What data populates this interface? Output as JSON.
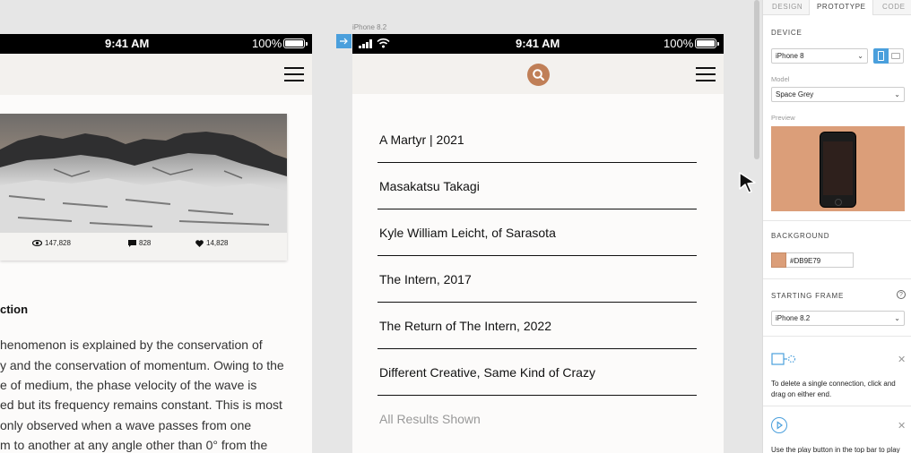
{
  "artboard_left": {
    "status": {
      "time": "9:41 AM",
      "battery": "100%"
    },
    "stats": {
      "views": "147,828",
      "comments": "828",
      "likes": "14,828"
    },
    "section_title": "ction",
    "body_lines": [
      "henomenon is explained by the conservation of",
      "y and the conservation of momentum. Owing to the",
      "e of medium, the phase velocity of the wave is",
      "ed but its frequency remains constant. This is most",
      "only observed when a wave passes from one",
      "m to another at any angle other than 0° from the"
    ]
  },
  "artboard_right": {
    "label": "iPhone 8.2",
    "status": {
      "time": "9:41 AM",
      "battery": "100%"
    },
    "results": [
      "A Martyr | 2021",
      "Masakatsu Takagi",
      "Kyle William Leicht, of Sarasota",
      "The Intern, 2017",
      "The Return of The Intern, 2022",
      "Different Creative, Same Kind of Crazy"
    ],
    "all_results": "All Results Shown"
  },
  "panel": {
    "tabs": [
      "DESIGN",
      "PROTOTYPE",
      "CODE"
    ],
    "active_tab": "PROTOTYPE",
    "device": {
      "heading": "DEVICE",
      "value": "iPhone 8"
    },
    "model": {
      "heading": "Model",
      "value": "Space Grey"
    },
    "preview": {
      "heading": "Preview"
    },
    "background": {
      "heading": "BACKGROUND",
      "hex": "#DB9E79"
    },
    "starting_frame": {
      "heading": "STARTING FRAME",
      "value": "iPhone 8.2"
    },
    "hint_connection": "To delete a single connection, click and drag on either end.",
    "hint_play": "Use the play button in the top bar to play"
  },
  "colors": {
    "accent_blue": "#4a9fdc",
    "preview_bg": "#db9e79",
    "search_button": "#c07f57"
  }
}
